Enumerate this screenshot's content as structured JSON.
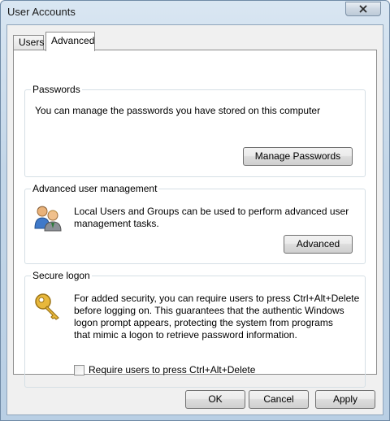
{
  "window": {
    "title": "User Accounts"
  },
  "tabs": [
    {
      "label": "Users"
    },
    {
      "label": "Advanced",
      "selected": true
    }
  ],
  "passwords": {
    "heading": "Passwords",
    "description": "You can manage the passwords you have stored on this computer",
    "button": "Manage Passwords"
  },
  "advanced_mgmt": {
    "heading": "Advanced user management",
    "description_line1": "Local Users and Groups can be used to perform advanced user",
    "description_line2": "management tasks.",
    "button": "Advanced",
    "icon": "users-group-icon"
  },
  "secure_logon": {
    "heading": "Secure logon",
    "description_line1": "For added security, you can require users to press Ctrl+Alt+Delete",
    "description_line2": "before logging on. This guarantees that the authentic Windows",
    "description_line3": "logon prompt appears, protecting the system from programs",
    "description_line4": "that mimic a logon to retrieve password information.",
    "checkbox_label": "Require users to press Ctrl+Alt+Delete",
    "checkbox_checked": false,
    "icon": "key-icon"
  },
  "buttons": {
    "ok": "OK",
    "cancel": "Cancel",
    "apply": "Apply"
  }
}
